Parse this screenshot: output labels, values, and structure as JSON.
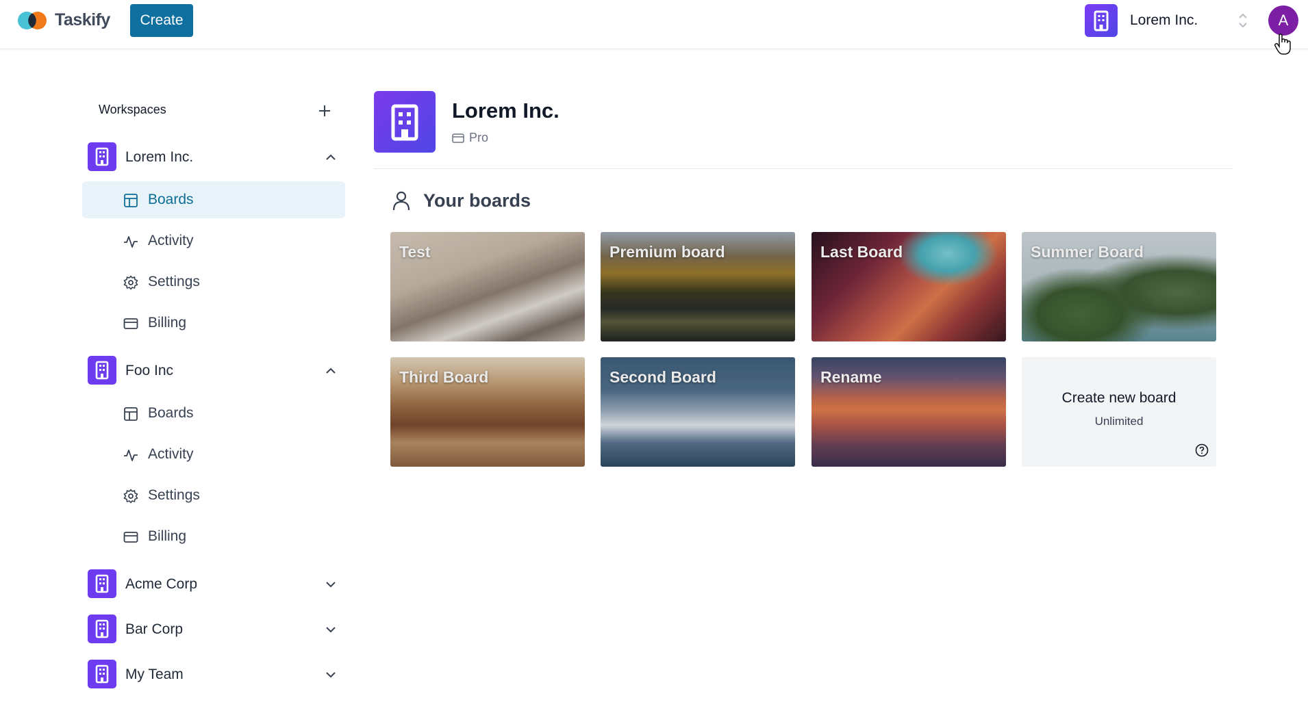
{
  "app": {
    "brand": "Taskify",
    "create_label": "Create",
    "current_org": "Lorem Inc.",
    "avatar_letter": "A",
    "accent": "#0f6f9e",
    "org_icon_color": "#6d3cf0"
  },
  "sidebar": {
    "title": "Workspaces",
    "add_icon": "plus-icon",
    "orgs": [
      {
        "name": "Lorem Inc.",
        "expanded": true,
        "items": [
          {
            "label": "Boards",
            "icon": "board-icon",
            "active": true
          },
          {
            "label": "Activity",
            "icon": "activity-icon"
          },
          {
            "label": "Settings",
            "icon": "gear-icon"
          },
          {
            "label": "Billing",
            "icon": "card-icon"
          }
        ]
      },
      {
        "name": "Foo Inc",
        "expanded": true,
        "items": [
          {
            "label": "Boards",
            "icon": "board-icon"
          },
          {
            "label": "Activity",
            "icon": "activity-icon"
          },
          {
            "label": "Settings",
            "icon": "gear-icon"
          },
          {
            "label": "Billing",
            "icon": "card-icon"
          }
        ]
      },
      {
        "name": "Acme Corp",
        "expanded": false
      },
      {
        "name": "Bar Corp",
        "expanded": false
      },
      {
        "name": "My Team",
        "expanded": false
      }
    ]
  },
  "main": {
    "workspace_name": "Lorem Inc.",
    "plan": "Pro",
    "section_title": "Your boards",
    "boards": [
      {
        "title": "Test",
        "theme": "snowy mountain"
      },
      {
        "title": "Premium board",
        "theme": "forest lake"
      },
      {
        "title": "Last Board",
        "theme": "red canyon"
      },
      {
        "title": "Summer Board",
        "theme": "palm trees"
      },
      {
        "title": "Third Board",
        "theme": "desert canyon"
      },
      {
        "title": "Second Board",
        "theme": "snowy peaks"
      },
      {
        "title": "Rename",
        "theme": "sunset horizon"
      }
    ],
    "create_card": {
      "title": "Create new board",
      "subtitle": "Unlimited",
      "icon": "help-icon"
    }
  }
}
